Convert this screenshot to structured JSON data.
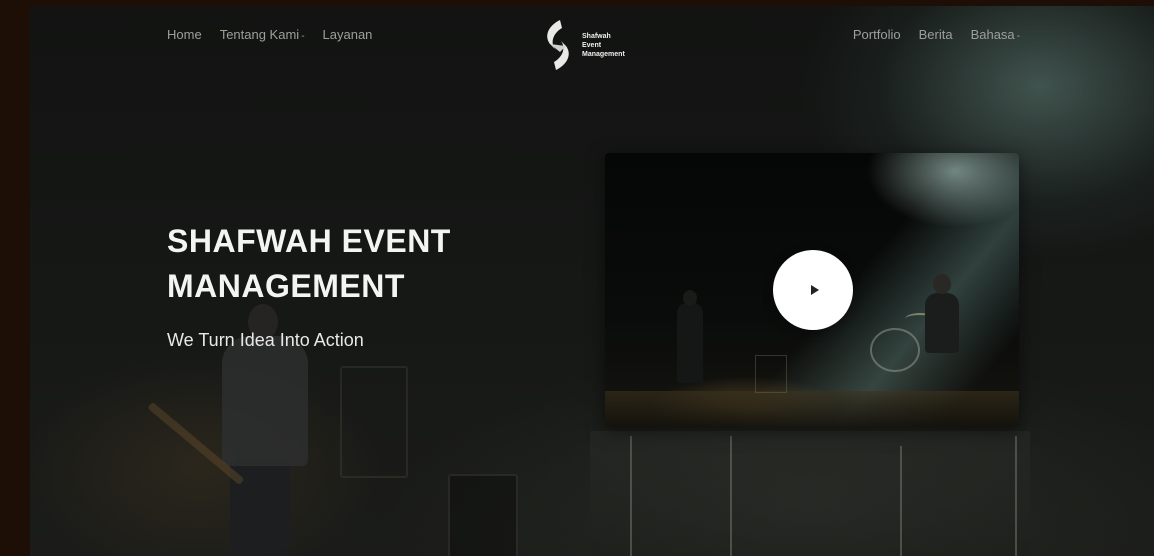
{
  "nav": {
    "left": [
      {
        "label": "Home",
        "dropdown": false
      },
      {
        "label": "Tentang Kami",
        "dropdown": true
      },
      {
        "label": "Layanan",
        "dropdown": false
      }
    ],
    "right": [
      {
        "label": "Portfolio",
        "dropdown": false
      },
      {
        "label": "Berita",
        "dropdown": false
      },
      {
        "label": "Bahasa",
        "dropdown": true
      }
    ],
    "caret": "-"
  },
  "logo": {
    "line1": "Shafwah",
    "line2": "Event",
    "line3": "Management",
    "icon": "shafwah-logo-icon"
  },
  "hero": {
    "title_line1": "SHAFWAH EVENT",
    "title_line2": "MANAGEMENT",
    "subtitle": "We Turn Idea Into Action"
  },
  "video": {
    "play_icon": "play-icon"
  },
  "colors": {
    "background": "#121312",
    "outer": "#1d0f06",
    "text": "#f4f4f2",
    "nav_text": "#9d9f9b",
    "play_button": "#ffffff"
  }
}
